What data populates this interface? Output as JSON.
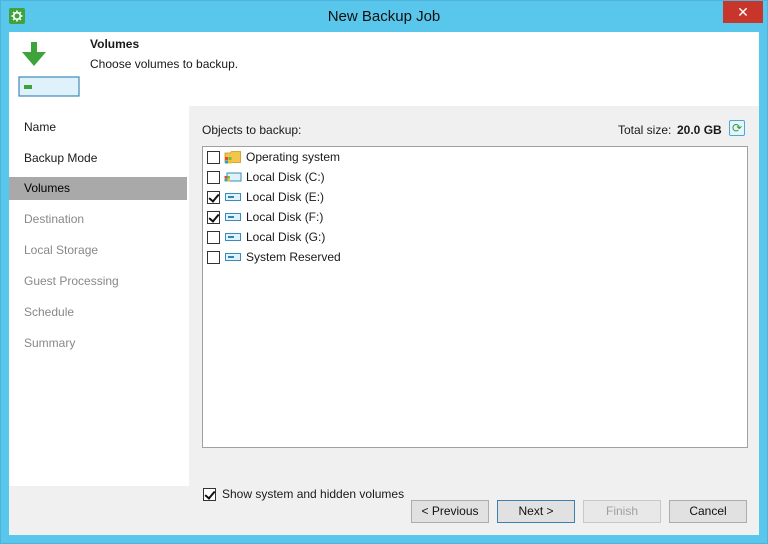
{
  "window": {
    "title": "New Backup Job",
    "close_glyph": "✕"
  },
  "header": {
    "title": "Volumes",
    "subtitle": "Choose volumes to backup."
  },
  "nav": {
    "items": [
      {
        "label": "Name",
        "state": "done"
      },
      {
        "label": "Backup Mode",
        "state": "done"
      },
      {
        "label": "Volumes",
        "state": "active"
      },
      {
        "label": "Destination",
        "state": "pending"
      },
      {
        "label": "Local Storage",
        "state": "pending"
      },
      {
        "label": "Guest Processing",
        "state": "pending"
      },
      {
        "label": "Schedule",
        "state": "pending"
      },
      {
        "label": "Summary",
        "state": "pending"
      }
    ]
  },
  "main": {
    "objects_label": "Objects to backup:",
    "total_size_label": "Total size:",
    "total_size_value": "20.0 GB",
    "refresh_icon": "refresh-icon",
    "items": [
      {
        "label": "Operating system",
        "checked": false,
        "icon": "windows-folder-icon"
      },
      {
        "label": "Local Disk (C:)",
        "checked": false,
        "icon": "windows-disk-icon"
      },
      {
        "label": "Local Disk (E:)",
        "checked": true,
        "icon": "disk-icon"
      },
      {
        "label": "Local Disk (F:)",
        "checked": true,
        "icon": "disk-icon"
      },
      {
        "label": "Local Disk (G:)",
        "checked": false,
        "icon": "disk-icon"
      },
      {
        "label": "System Reserved",
        "checked": false,
        "icon": "disk-icon"
      }
    ],
    "show_hidden": {
      "label": "Show system and hidden volumes",
      "checked": true
    }
  },
  "buttons": {
    "previous": "< Previous",
    "next": "Next >",
    "finish": "Finish",
    "cancel": "Cancel"
  },
  "colors": {
    "titlebar": "#59c6ec",
    "close": "#c7352b",
    "accent_green": "#3fa33b"
  }
}
